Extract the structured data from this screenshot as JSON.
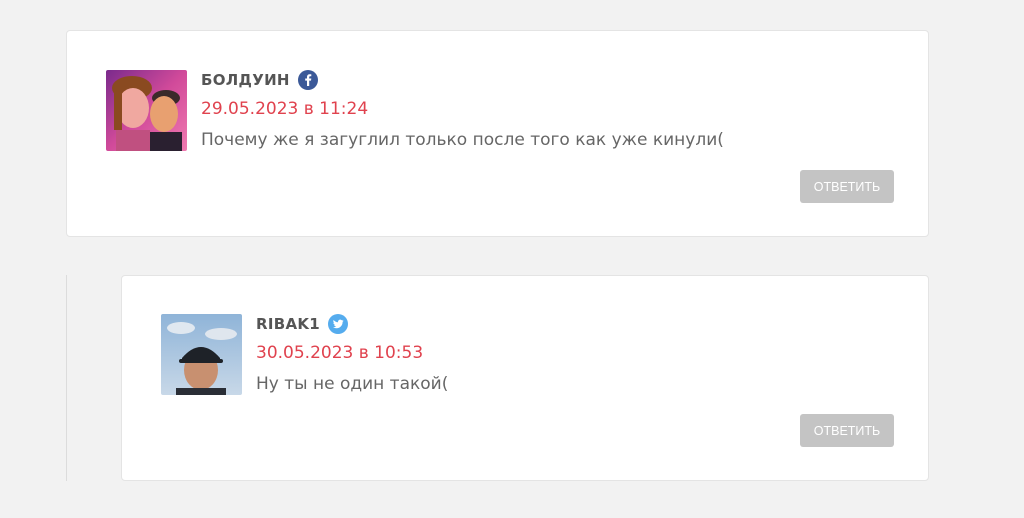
{
  "comments": [
    {
      "author": "БОЛДУИН",
      "social_icon": "facebook-icon",
      "social_color": "#3b5998",
      "date": "29.05.2023 в 11:24",
      "text": "Почему же я загуглил только после того как уже кинули(",
      "reply_label": "ОТВЕТИТЬ"
    },
    {
      "author": "RIBAK1",
      "social_icon": "twitter-icon",
      "social_color": "#55acee",
      "date": "30.05.2023 в 10:53",
      "text": "Ну ты не один такой(",
      "reply_label": "ОТВЕТИТЬ"
    }
  ],
  "colors": {
    "date": "#e0424e",
    "button": "#c4c4c4",
    "background": "#f2f2f2"
  }
}
